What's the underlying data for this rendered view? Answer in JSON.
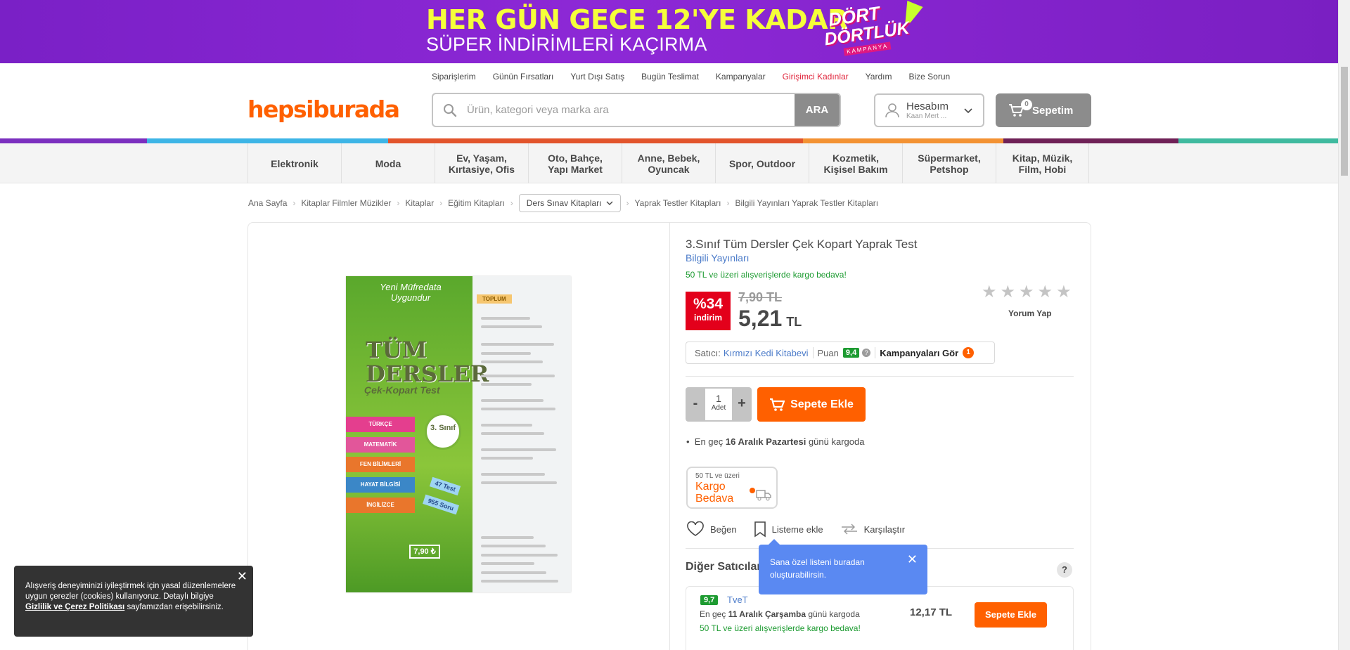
{
  "promo": {
    "line1": "HER GÜN GECE 12'YE KADAR",
    "line2": "SÜPER İNDİRİMLERİ KAÇIRMA",
    "logo_line1": "DÖRT",
    "logo_line2": "DÖRTLÜK",
    "logo_line3": "KAMPANYA"
  },
  "top_links": [
    "Siparişlerim",
    "Günün Fırsatları",
    "Yurt Dışı Satış",
    "Bugün Teslimat",
    "Kampanyalar",
    "Girişimci Kadınlar",
    "Yardım",
    "Bize Sorun"
  ],
  "header": {
    "logo": "hepsiburada",
    "search_placeholder": "Ürün, kategori veya marka ara",
    "search_button": "ARA",
    "account_title": "Hesabım",
    "account_sub": "Kaan Mert ...",
    "cart_label": "Sepetim",
    "cart_count": "0"
  },
  "stripe_colors": [
    "#7b2fbf",
    "#3db5e6",
    "#e2542b",
    "#f39233",
    "#6f2157",
    "#3fba9f"
  ],
  "categories": [
    [
      "Elektronik"
    ],
    [
      "Moda"
    ],
    [
      "Ev, Yaşam,",
      "Kırtasiye, Ofis"
    ],
    [
      "Oto, Bahçe,",
      "Yapı Market"
    ],
    [
      "Anne, Bebek,",
      "Oyuncak"
    ],
    [
      "Spor, Outdoor"
    ],
    [
      "Kozmetik,",
      "Kişisel Bakım"
    ],
    [
      "Süpermarket,",
      "Petshop"
    ],
    [
      "Kitap, Müzik,",
      "Film, Hobi"
    ]
  ],
  "breadcrumb": [
    "Ana Sayfa",
    "Kitaplar Filmler Müzikler",
    "Kitaplar",
    "Eğitim Kitapları",
    "Ders Sınav Kitapları",
    "Yaprak Testler Kitapları",
    "Bilgili Yayınları Yaprak Testler Kitapları"
  ],
  "book": {
    "top": "Yeni Müfredata Uygundur",
    "title": "TÜM DERSLER",
    "subtitle": "Çek-Kopart Test",
    "grade": "3. Sınıf",
    "toplum": "TOPLUM",
    "tabs": [
      "TÜRKÇE",
      "MATEMATİK",
      "FEN BİLİMLERİ",
      "HAYAT BİLGİSİ",
      "İNGİLİZCE"
    ],
    "tab_colors": [
      "#e43e8e",
      "#e2569a",
      "#e9762c",
      "#3b87c7",
      "#e9762c"
    ],
    "ribbon1": "47 Test",
    "ribbon2": "955 Soru",
    "price": "7,90 ₺"
  },
  "product": {
    "title": "3.Sınıf Tüm Dersler Çek Kopart Yaprak Test",
    "brand": "Bilgili Yayınları",
    "kargo_note": "50 TL ve üzeri alışverişlerde kargo bedava!",
    "discount_pct": "%34",
    "discount_label": "indirim",
    "old_price": "7,90 TL",
    "new_price": "5,21",
    "currency": "TL",
    "rating_stars": 0,
    "review_link": "Yorum Yap",
    "seller_label": "Satıcı:",
    "seller_name": "Kırmızı Kedi Kitabevi",
    "score_label": "Puan",
    "score": "9,4",
    "campaign_link": "Kampanyaları Gör",
    "campaign_count": "1",
    "qty": "1",
    "qty_unit": "Adet",
    "add_to_cart": "Sepete Ekle",
    "delivery_prefix": "En geç",
    "delivery_date": "16 Aralık Pazartesi",
    "delivery_suffix": "günü kargoda",
    "free_ship_small": "50 TL ve üzeri",
    "free_ship_big1": "Kargo",
    "free_ship_big2": "Bedava",
    "like": "Beğen",
    "list_add": "Listeme ekle",
    "compare": "Karşılaştır"
  },
  "tooltip": {
    "text1": "Sana özel listeni buradan",
    "text2": "oluşturabilirsin."
  },
  "other_sellers": {
    "title": "Diğer Satıcılar",
    "seller_score": "9,7",
    "seller_name": "TveT",
    "delivery_prefix": "En geç",
    "delivery_date": "11 Aralık Çarşamba",
    "delivery_suffix": "günü kargoda",
    "kargo_note": "50 TL ve üzeri alışverişlerde kargo bedava!",
    "price": "12,17 TL",
    "button": "Sepete Ekle"
  },
  "cookie": {
    "text1": "Alışveriş deneyiminizi iyileştirmek için yasal düzenlemelere uygun çerezler (cookies) kullanıyoruz. Detaylı bilgiye",
    "link": "Gizlilik ve Çerez Politikası",
    "text2": "sayfamızdan erişebilirsiniz."
  }
}
